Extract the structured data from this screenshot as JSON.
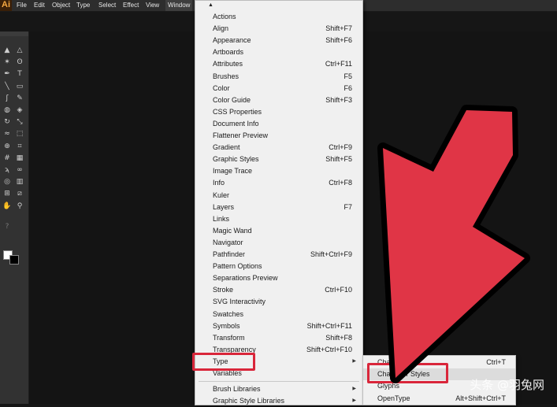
{
  "app": {
    "logo": "Ai"
  },
  "menubar": {
    "items": [
      {
        "label": "File"
      },
      {
        "label": "Edit"
      },
      {
        "label": "Object"
      },
      {
        "label": "Type"
      },
      {
        "label": "Select"
      },
      {
        "label": "Effect"
      },
      {
        "label": "View"
      },
      {
        "label": "Window"
      }
    ]
  },
  "window_menu": {
    "scroll_up_glyph": "▲",
    "items": [
      {
        "label": "Actions",
        "shortcut": ""
      },
      {
        "label": "Align",
        "shortcut": "Shift+F7"
      },
      {
        "label": "Appearance",
        "shortcut": "Shift+F6"
      },
      {
        "label": "Artboards",
        "shortcut": ""
      },
      {
        "label": "Attributes",
        "shortcut": "Ctrl+F11"
      },
      {
        "label": "Brushes",
        "shortcut": "F5"
      },
      {
        "label": "Color",
        "shortcut": "F6"
      },
      {
        "label": "Color Guide",
        "shortcut": "Shift+F3"
      },
      {
        "label": "CSS Properties",
        "shortcut": ""
      },
      {
        "label": "Document Info",
        "shortcut": ""
      },
      {
        "label": "Flattener Preview",
        "shortcut": ""
      },
      {
        "label": "Gradient",
        "shortcut": "Ctrl+F9"
      },
      {
        "label": "Graphic Styles",
        "shortcut": "Shift+F5"
      },
      {
        "label": "Image Trace",
        "shortcut": ""
      },
      {
        "label": "Info",
        "shortcut": "Ctrl+F8"
      },
      {
        "label": "Kuler",
        "shortcut": ""
      },
      {
        "label": "Layers",
        "shortcut": "F7"
      },
      {
        "label": "Links",
        "shortcut": ""
      },
      {
        "label": "Magic Wand",
        "shortcut": ""
      },
      {
        "label": "Navigator",
        "shortcut": ""
      },
      {
        "label": "Pathfinder",
        "shortcut": "Shift+Ctrl+F9"
      },
      {
        "label": "Pattern Options",
        "shortcut": ""
      },
      {
        "label": "Separations Preview",
        "shortcut": ""
      },
      {
        "label": "Stroke",
        "shortcut": "Ctrl+F10"
      },
      {
        "label": "SVG Interactivity",
        "shortcut": ""
      },
      {
        "label": "Swatches",
        "shortcut": ""
      },
      {
        "label": "Symbols",
        "shortcut": "Shift+Ctrl+F11"
      },
      {
        "label": "Transform",
        "shortcut": "Shift+F8"
      },
      {
        "label": "Transparency",
        "shortcut": "Shift+Ctrl+F10"
      },
      {
        "label": "Type",
        "shortcut": "",
        "submenu": true,
        "highlighted": true
      },
      {
        "label": "Variables",
        "shortcut": ""
      },
      {
        "label": "Brush Libraries",
        "shortcut": "",
        "submenu": true
      },
      {
        "label": "Graphic Style Libraries",
        "shortcut": "",
        "submenu": true
      }
    ],
    "submenu_glyph": "▶"
  },
  "type_submenu": {
    "items": [
      {
        "label": "Character",
        "shortcut": "Ctrl+T"
      },
      {
        "label": "Character Styles",
        "shortcut": "",
        "highlighted": true
      },
      {
        "label": "Glyphs",
        "shortcut": ""
      },
      {
        "label": "OpenType",
        "shortcut": "Alt+Shift+Ctrl+T"
      }
    ]
  },
  "toolbar": {
    "tools": [
      "selection-tool",
      "direct-selection-tool",
      "magic-wand-tool",
      "lasso-tool",
      "pen-tool",
      "type-tool",
      "line-tool",
      "rectangle-tool",
      "paintbrush-tool",
      "pencil-tool",
      "blob-brush-tool",
      "eraser-tool",
      "rotate-tool",
      "scale-tool",
      "warp-tool",
      "free-transform-tool",
      "shape-builder-tool",
      "perspective-grid-tool",
      "mesh-tool",
      "gradient-tool",
      "eyedropper-tool",
      "blend-tool",
      "symbol-sprayer-tool",
      "column-graph-tool",
      "artboard-tool",
      "slice-tool",
      "hand-tool",
      "zoom-tool"
    ],
    "glyphs": [
      "▲",
      "△",
      "✶",
      "ʘ",
      "✒",
      "T",
      "╲",
      "▭",
      "ʃ",
      "✎",
      "◍",
      "◈",
      "↻",
      "⤡",
      "≈",
      "⬚",
      "⊕",
      "⌗",
      "#",
      "▦",
      "ϡ",
      "∞",
      "◎",
      "▥",
      "⊞",
      "⧄",
      "✋",
      "⚲"
    ],
    "question_glyph": "?",
    "fill_color": "#ffffff",
    "stroke_color": "#000000"
  },
  "colors": {
    "annotation_red": "#d9263a",
    "arrow_red": "#e03546"
  },
  "watermark": {
    "text": "头条 @羽兔网"
  }
}
